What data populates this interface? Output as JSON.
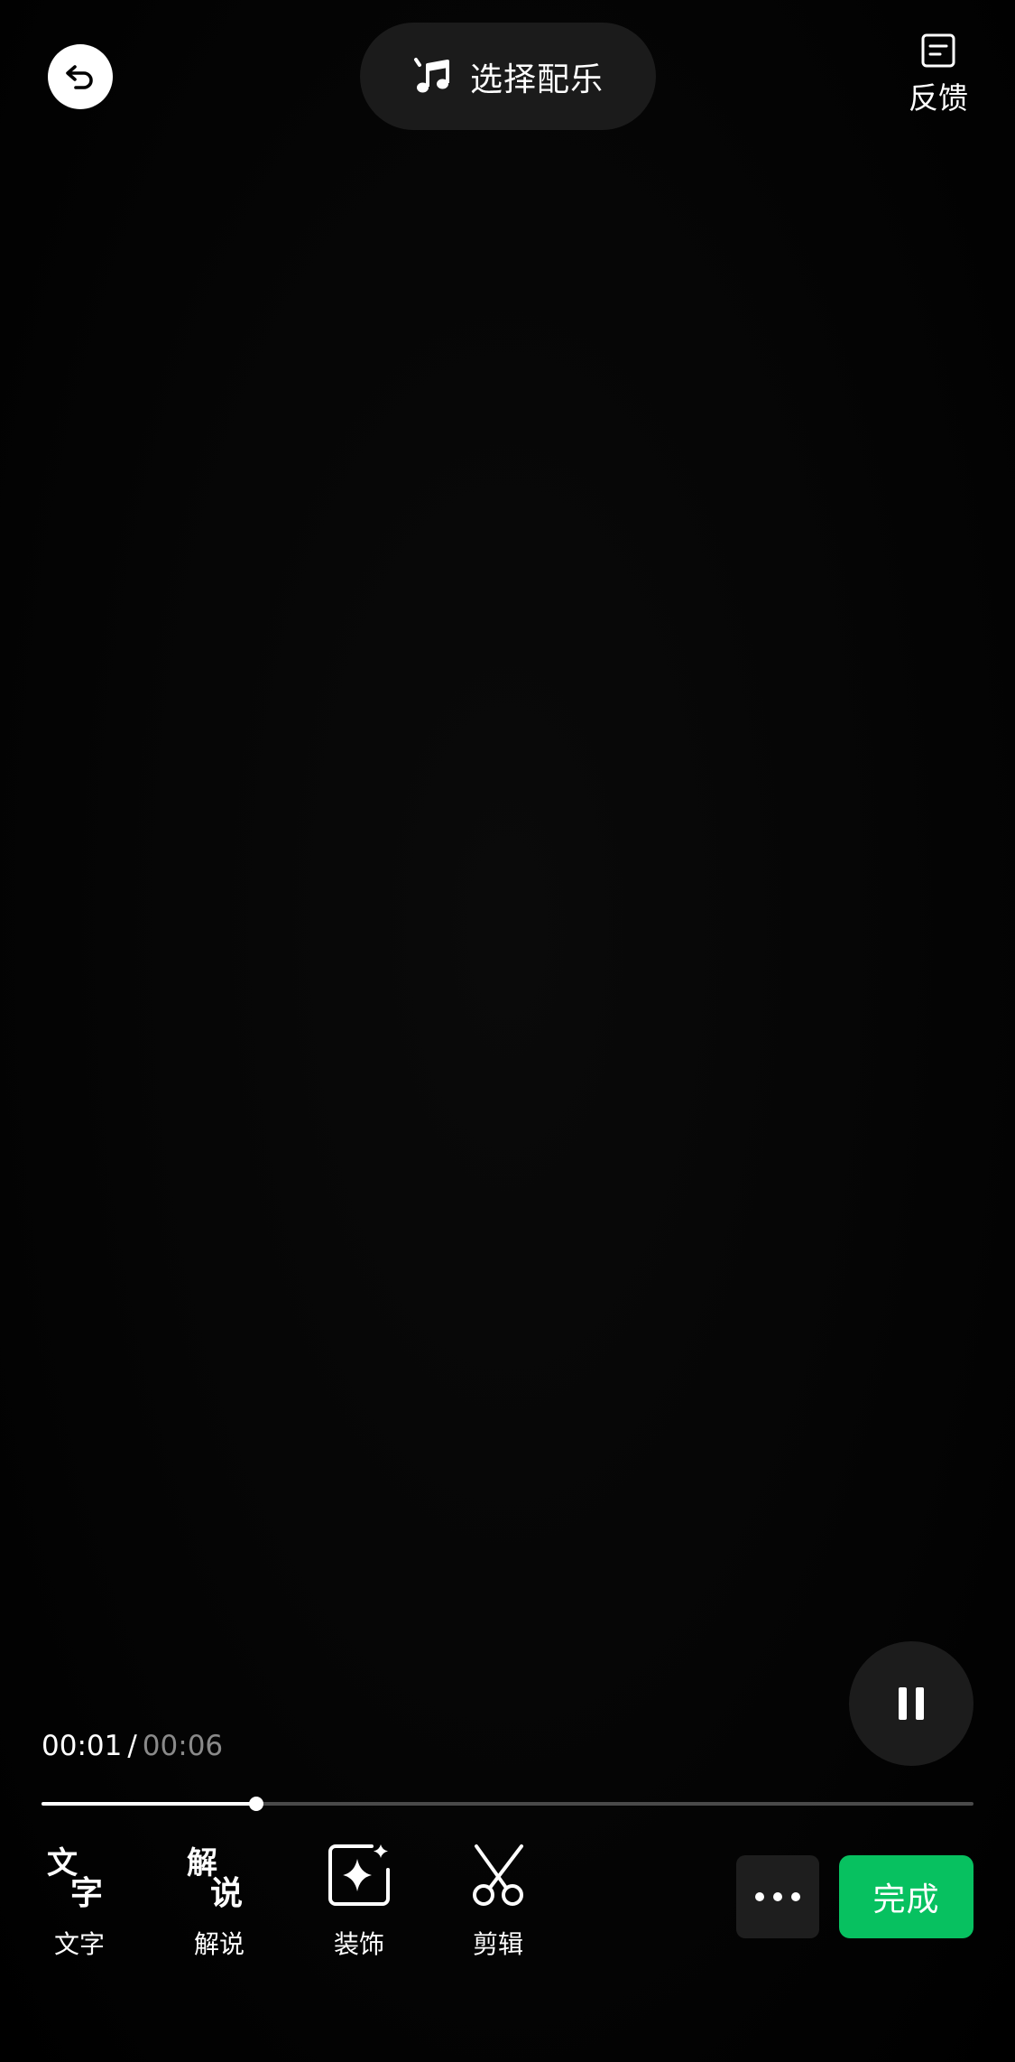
{
  "top_bar": {
    "back_icon": "undo-arrow-icon",
    "music_label": "选择配乐",
    "music_icon": "music-note-icon",
    "feedback_label": "反馈",
    "feedback_icon": "document-icon"
  },
  "player": {
    "current_time": "00:01",
    "separator": "/",
    "total_time": "00:06",
    "progress_fraction": 0.23,
    "state_icon": "pause-icon"
  },
  "toolbar": {
    "items": [
      {
        "label": "文字",
        "icon": "text-glyph-icon",
        "glyph_top": "文",
        "glyph_bottom": "字"
      },
      {
        "label": "解说",
        "icon": "narration-glyph-icon",
        "glyph_top": "解",
        "glyph_bottom": "说"
      },
      {
        "label": "装饰",
        "icon": "sparkle-icon"
      },
      {
        "label": "剪辑",
        "icon": "scissors-icon"
      }
    ],
    "more_icon": "more-dots-icon",
    "done_label": "完成"
  },
  "colors": {
    "accent_green": "#07c160",
    "background": "#000000",
    "pill_background": "#1b1b1b"
  }
}
